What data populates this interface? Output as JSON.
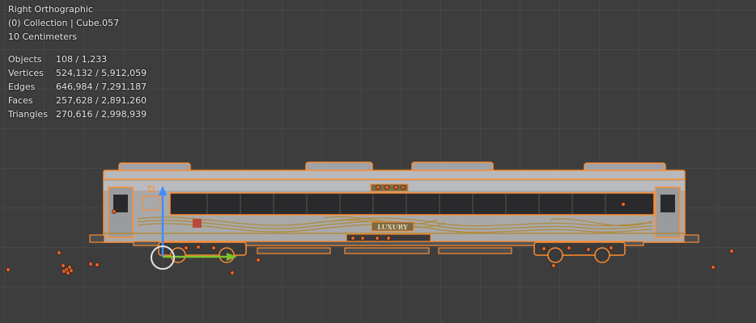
{
  "viewport": {
    "view_name": "Right Orthographic",
    "collection_info": "(0) Collection | Cube.057",
    "scale_info": "10 Centimeters",
    "grid_color": "#474747",
    "background_color": "#3d3d3d",
    "selection_color": "#ff8c2e"
  },
  "stats": [
    {
      "label": "Objects",
      "value": "108 / 1,233"
    },
    {
      "label": "Vertices",
      "value": "524,132 / 5,912,059"
    },
    {
      "label": "Edges",
      "value": "646,984 / 7,291,187"
    },
    {
      "label": "Faces",
      "value": "257,628 / 2,891,260"
    },
    {
      "label": "Triangles",
      "value": "270,616 / 2,998,939"
    }
  ],
  "model": {
    "side_label": "LUXURY"
  },
  "icons": [
    "move-gizmo-y-arrow-icon",
    "move-gizmo-z-arrow-icon",
    "gizmo-origin-circle-icon",
    "object-origin-dot-icon"
  ]
}
